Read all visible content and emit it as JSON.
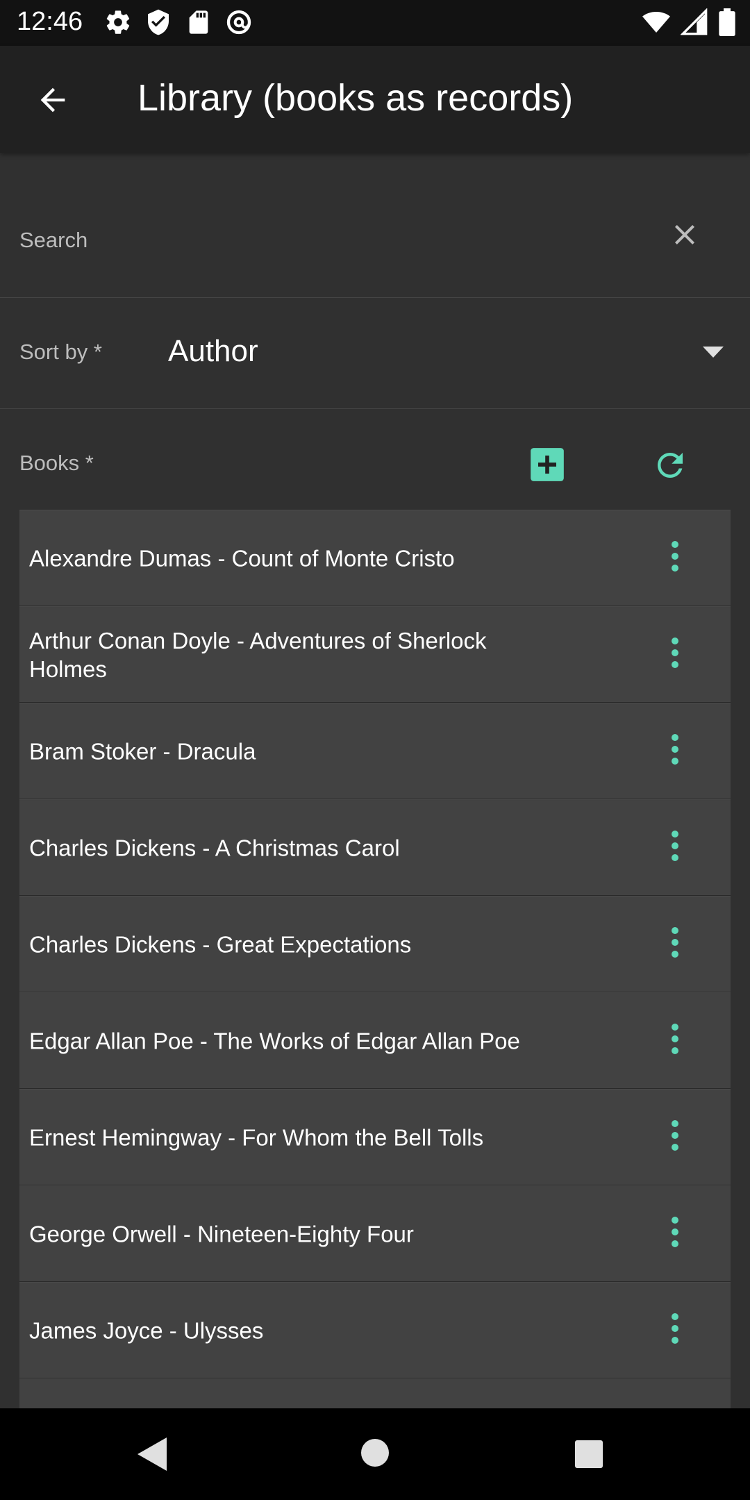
{
  "status_bar": {
    "time": "12:46",
    "left_icons": [
      "settings-icon",
      "shield-icon",
      "sd-card-icon",
      "at-sign-icon"
    ],
    "right_icons": [
      "wifi-icon",
      "signal-icon",
      "battery-icon"
    ]
  },
  "app_bar": {
    "title": "Library (books as records)",
    "back_icon": "arrow-back-icon"
  },
  "search": {
    "placeholder": "Search",
    "value": "",
    "clear_icon": "close-icon"
  },
  "sort": {
    "label": "Sort by *",
    "selected": "Author",
    "caret_icon": "dropdown-caret-icon"
  },
  "books": {
    "label": "Books *",
    "add_icon": "add-box-icon",
    "refresh_icon": "refresh-icon",
    "items": [
      {
        "title": "Alexandre Dumas - Count of Monte Cristo"
      },
      {
        "title": "Arthur Conan Doyle - Adventures of Sherlock Holmes"
      },
      {
        "title": "Bram Stoker - Dracula"
      },
      {
        "title": "Charles Dickens - A Christmas Carol"
      },
      {
        "title": "Charles Dickens - Great Expectations"
      },
      {
        "title": "Edgar Allan Poe - The Works of Edgar Allan Poe"
      },
      {
        "title": "Ernest Hemingway - For Whom the Bell Tolls"
      },
      {
        "title": "George Orwell - Nineteen-Eighty Four"
      },
      {
        "title": "James Joyce - Ulysses"
      },
      {
        "title": ""
      }
    ]
  },
  "colors": {
    "accent": "#5fd9b8",
    "background": "#303030",
    "app_bar": "#212121",
    "list_item": "#424242"
  },
  "nav_bar": {
    "icons": [
      "nav-back-icon",
      "nav-home-icon",
      "nav-recents-icon"
    ]
  }
}
